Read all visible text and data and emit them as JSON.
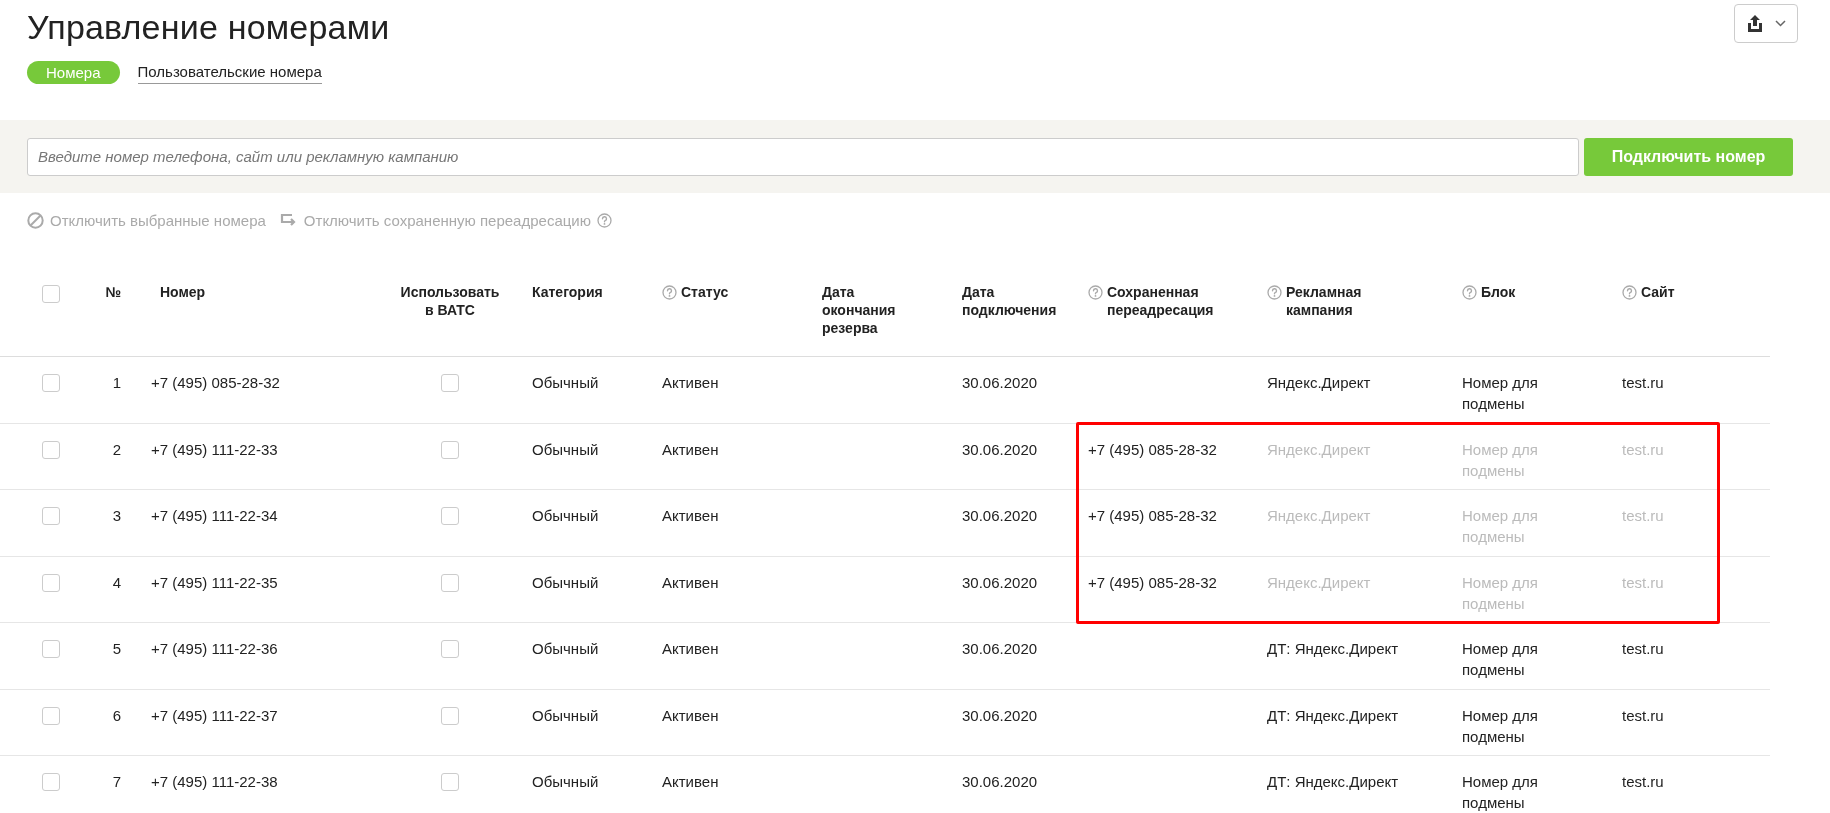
{
  "page": {
    "title": "Управление номерами"
  },
  "tabs": [
    {
      "label": "Номера",
      "selected": true
    },
    {
      "label": "Пользовательские номера",
      "selected": false
    }
  ],
  "search": {
    "placeholder": "Введите номер телефона, сайт или рекламную кампанию",
    "button": "Подключить номер"
  },
  "actions": [
    {
      "kind": "disable",
      "label": "Отключить выбранные номера",
      "disabled": true,
      "help": false
    },
    {
      "kind": "redirect",
      "label": "Отключить сохраненную переадресацию",
      "disabled": true,
      "help": true
    }
  ],
  "table": {
    "select_all": {
      "checked": false
    },
    "columns": [
      {
        "label": "№",
        "help": false
      },
      {
        "label": "Номер",
        "help": false
      },
      {
        "label": "Использовать в ВАТС",
        "help": false
      },
      {
        "label": "Категория",
        "help": false
      },
      {
        "label": "Статус",
        "help": true
      },
      {
        "label": "Дата окончания резерва",
        "help": false
      },
      {
        "label": "Дата подключения",
        "help": false
      },
      {
        "label": "Сохраненная переадресация",
        "help": true
      },
      {
        "label": "Рекламная кампания",
        "help": true
      },
      {
        "label": "Блок",
        "help": true
      },
      {
        "label": "Сайт",
        "help": true
      }
    ],
    "rows": [
      {
        "checked": false,
        "number": "1",
        "phone": "+7 (495) 085-28-32",
        "use_in_vats": false,
        "category": "Обычный",
        "status": "Активен",
        "connected": "30.06.2020",
        "campaign": "Яндекс.Директ",
        "block": "Номер для подмены",
        "site": "test.ru",
        "highlighted": false
      },
      {
        "checked": false,
        "number": "2",
        "phone": "+7 (495) 111-22-33",
        "use_in_vats": false,
        "category": "Обычный",
        "status": "Активен",
        "connected": "30.06.2020",
        "saved_redirect": "+7 (495) 085-28-32",
        "campaign": "Яндекс.Директ",
        "block": "Номер для подмены",
        "site": "test.ru",
        "highlighted": true
      },
      {
        "checked": false,
        "number": "3",
        "phone": "+7 (495) 111-22-34",
        "use_in_vats": false,
        "category": "Обычный",
        "status": "Активен",
        "connected": "30.06.2020",
        "saved_redirect": "+7 (495) 085-28-32",
        "campaign": "Яндекс.Директ",
        "block": "Номер для подмены",
        "site": "test.ru",
        "highlighted": true
      },
      {
        "checked": false,
        "number": "4",
        "phone": "+7 (495) 111-22-35",
        "use_in_vats": false,
        "category": "Обычный",
        "status": "Активен",
        "connected": "30.06.2020",
        "saved_redirect": "+7 (495) 085-28-32",
        "campaign": "Яндекс.Директ",
        "block": "Номер для подмены",
        "site": "test.ru",
        "highlighted": true
      },
      {
        "checked": false,
        "number": "5",
        "phone": "+7 (495) 111-22-36",
        "use_in_vats": false,
        "category": "Обычный",
        "status": "Активен",
        "connected": "30.06.2020",
        "campaign": "ДТ: Яндекс.Директ",
        "block": "Номер для подмены",
        "site": "test.ru",
        "highlighted": false
      },
      {
        "checked": false,
        "number": "6",
        "phone": "+7 (495) 111-22-37",
        "use_in_vats": false,
        "category": "Обычный",
        "status": "Активен",
        "connected": "30.06.2020",
        "campaign": "ДТ: Яндекс.Директ",
        "block": "Номер для подмены",
        "site": "test.ru",
        "highlighted": false
      },
      {
        "checked": false,
        "number": "7",
        "phone": "+7 (495) 111-22-38",
        "use_in_vats": false,
        "category": "Обычный",
        "status": "Активен",
        "connected": "30.06.2020",
        "campaign": "ДТ: Яндекс.Директ",
        "block": "Номер для подмены",
        "site": "test.ru",
        "highlighted": false
      }
    ]
  }
}
